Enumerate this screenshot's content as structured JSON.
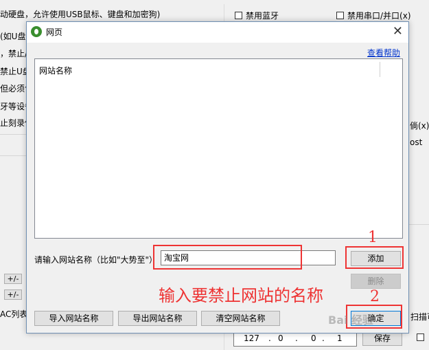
{
  "background": {
    "left_lines": [
      "动硬盘，允许使用USB鼠标、键盘和加密狗)",
      "(如U盘",
      "，禁止/",
      "禁止U盘",
      "但必须包",
      "牙等设备",
      "止刻录使"
    ],
    "checkbox_bluetooth": "禁用蓝牙",
    "checkbox_serial": "禁用串口/并口(x)",
    "right_fragments": [
      "倘(x)",
      "ost"
    ],
    "pm_buttons": [
      "+/-",
      "+/-"
    ],
    "ac_list_label": "AC列表",
    "ip": [
      "127",
      ".",
      "0",
      ".",
      "0",
      ".",
      "1"
    ],
    "save_label": "保存",
    "right_bottom_text": "扫描可"
  },
  "dialog": {
    "title": "网页",
    "close_glyph": "✕",
    "help_link": "查看帮助",
    "list_header": "网站名称",
    "input_label": "请输入网站名称（比如\"大势至\"）",
    "input_value": "淘宝网",
    "add_button": "添加",
    "delete_button": "删除",
    "import_button": "导入网站名称",
    "export_button": "导出网站名称",
    "clear_button": "清空网站名称",
    "ok_button": "确定"
  },
  "annotations": {
    "step1": "1",
    "step2": "2",
    "note": "输入要禁止网站的名称"
  },
  "watermark": "Bai 经验",
  "colors": {
    "annotation_red": "#e33333",
    "link_blue": "#0033cc",
    "app_icon_green": "#3a8e2e"
  }
}
